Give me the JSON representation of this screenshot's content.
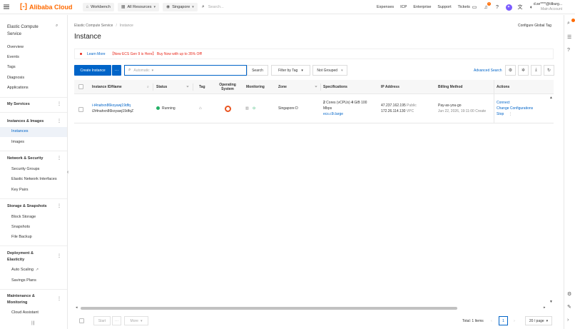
{
  "topbar": {
    "brand": "Alibaba Cloud",
    "workbench": "Workbench",
    "all_resources": "All Resources",
    "region": "Singapore",
    "search_placeholder": "Search...",
    "links": [
      "Expenses",
      "ICP",
      "Enterprise",
      "Support",
      "Tickets"
    ],
    "notification_count": "1",
    "user_name": "d.se****@tilburg...",
    "user_role": "Main Account"
  },
  "sidebar": {
    "title": "Elastic Compute Service",
    "top_items": [
      "Overview",
      "Events",
      "Tags",
      "Diagnosis",
      "Applications"
    ],
    "my_services": "My Services",
    "groups": {
      "instances_images": {
        "label": "Instances & Images",
        "items": [
          "Instances",
          "Images"
        ]
      },
      "network_security": {
        "label": "Network & Security",
        "items": [
          "Security Groups",
          "Elastic Network Interfaces",
          "Key Pairs"
        ]
      },
      "storage": {
        "label": "Storage & Snapshots",
        "items": [
          "Block Storage",
          "Snapshots",
          "File Backup"
        ]
      },
      "deployment": {
        "label": "Deployment & Elasticity",
        "items": [
          "Auto Scaling",
          "Savings Plans"
        ]
      },
      "maintenance": {
        "label": "Maintenance & Monitoring",
        "items": [
          "Cloud Assistant"
        ]
      }
    }
  },
  "breadcrumb": [
    "Elastic Compute Service",
    "Instance"
  ],
  "page_title": "Instance",
  "configure_global_tag": "Configure Global Tag",
  "notice": {
    "learn_more": "Learn More",
    "promo": "【New ECS Gen 9 is Here】 Buy Now with up to 35% Off!"
  },
  "toolbar": {
    "create_instance": "Create Instance",
    "more": "···",
    "search_placeholder": "Automatic",
    "search": "Search",
    "filter_by_tag": "Filter by Tag",
    "not_grouped": "Not Grouped",
    "advanced_search": "Advanced Search"
  },
  "table": {
    "headers": {
      "instance_id": "Instance ID/Name",
      "status": "Status",
      "tag": "Tag",
      "os": "Operating System",
      "monitoring": "Monitoring",
      "zone": "Zone",
      "specs": "Specifications",
      "ip": "IP Address",
      "billing": "Billing Method",
      "actions": "Actions"
    },
    "row": {
      "instance_id": "i-t4nahxn86koyawj19dfq",
      "instance_name": "i2t4nahxn86koyawj19dfqZ",
      "status": "Running",
      "zone": "Singapore D",
      "spec_cores": "2",
      "spec_cores_label": "Cores (vCPUs)",
      "spec_mem": "4",
      "spec_mem_label": "GiB",
      "spec_bw": "100",
      "spec_bw_label": "Mbps",
      "spec_type": "ecs.c9i.large",
      "public_ip": "47.237.162.195",
      "public_label": "Public",
      "private_ip": "172.26.114.130",
      "private_label": "VPC",
      "billing": "Pay-as-you-go",
      "created": "Jun 22, 2026, 19:11:00",
      "created_label": "Create",
      "action_connect": "Connect",
      "action_change": "Change Configurations",
      "action_stop": "Stop"
    }
  },
  "footer": {
    "start": "Start",
    "more_dots": "···",
    "more": "More",
    "total": "Total: 1 Items",
    "page": "1",
    "page_size": "20 / page"
  }
}
